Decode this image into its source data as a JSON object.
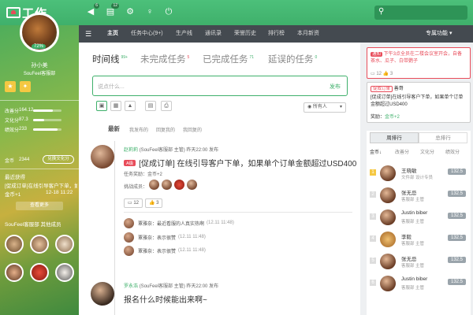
{
  "topbar": {
    "logo_text": "工作",
    "icons": [
      {
        "name": "speaker-icon",
        "badge": "6"
      },
      {
        "name": "notes-icon",
        "badge": "12"
      },
      {
        "name": "settings-icon",
        "badge": ""
      },
      {
        "name": "bulb-icon",
        "badge": ""
      },
      {
        "name": "location-icon",
        "badge": ""
      },
      {
        "name": "power-icon",
        "badge": ""
      }
    ]
  },
  "profile": {
    "name": "孙小美",
    "role": "SouFeel客服部",
    "progress_label": "72%",
    "stats": [
      {
        "label": "改善分",
        "value": "164.12",
        "fill": 0.7
      },
      {
        "label": "文化分",
        "value": "87.3",
        "fill": 0.4
      },
      {
        "label": "绩效分",
        "value": "233",
        "fill": 0.85
      }
    ],
    "gold_label": "金币",
    "gold_value": "2344",
    "convert_label": "兑换文化分",
    "recent_title": "最近获得",
    "recent_text": "[促成订单]在线引导客户下单，如果单个...",
    "recent_reward": "金币+1",
    "recent_time": "12-18 11:22",
    "more_label": "查看更多",
    "members_title": "SouFeel客服部 其他成员"
  },
  "nav": {
    "items": [
      "主页",
      "任务中心(9+)",
      "生产线",
      "通讯录",
      "荣誉历史",
      "排行榜",
      "本月新资"
    ],
    "right": "专属功能"
  },
  "main": {
    "tabs": [
      {
        "label": "时间线",
        "count": "99+"
      },
      {
        "label": "未完成任务",
        "count": "5"
      },
      {
        "label": "已完成任务",
        "count": "71"
      },
      {
        "label": "延误的任务",
        "count": "0"
      }
    ],
    "compose_placeholder": "说点什么...",
    "publish_label": "发布",
    "visibility": "所有人",
    "feed_tabs": [
      "最新",
      "我发布的",
      "回复我的",
      "我回复的"
    ],
    "post1": {
      "author": "赵莉莉",
      "dept": "(SouFeel客服部 主管)",
      "time": "昨天22:00 发布",
      "tag": "A级",
      "title": "[促成订单] 在线引导客户下单，如果单个订单金额超过USD400",
      "reward_label": "任务奖励：",
      "reward_value": "金币+2",
      "members_label": "挑战成员：",
      "comments": "12",
      "likes": "3"
    },
    "replies": [
      {
        "name": "覃雅奈",
        "text": "最近看服的人真实热啊",
        "time": "(12.11 11:48)"
      },
      {
        "name": "覃雅奈",
        "text": "表示很赞",
        "time": "(12.11 11:48)"
      },
      {
        "name": "覃雅奈",
        "text": "表示很赞",
        "time": "(12.11 11:48)"
      }
    ],
    "post2": {
      "author": "罗永浩",
      "dept": "(SouFeel客服部 主管)",
      "time": "昨天22:00 发布",
      "title": "报名什么时候能出来啊~"
    }
  },
  "notices": [
    {
      "tag": "通知",
      "text": "下午3点全员在二楼会议室开会，自备茶水、瓜子、白带鹦子",
      "comments": "12",
      "likes": "3"
    },
    {
      "tag": "促成订单",
      "author": "善哥",
      "text": "[促成订单]在线引导客户下单，如果单个订单金额超过USD400",
      "reward_label": "奖励：",
      "reward_value": "金币+2"
    }
  ],
  "ranking": {
    "tabs": [
      "周排行",
      "总排行"
    ],
    "cols": [
      "金币↓",
      "改善分",
      "文化分",
      "绩效分"
    ],
    "rows": [
      {
        "rank": "1",
        "name": "王晓敏",
        "dept": "文件部 设计专员",
        "score": "132.5"
      },
      {
        "rank": "2",
        "name": "张无忌",
        "dept": "客服部 主管",
        "score": "132.5"
      },
      {
        "rank": "3",
        "name": "Justin biber",
        "dept": "客服部 主管",
        "score": "132.5"
      },
      {
        "rank": "4",
        "name": "李毅",
        "dept": "客服部 主管",
        "score": "132.5"
      },
      {
        "rank": "5",
        "name": "张无忌",
        "dept": "客服部 主管",
        "score": "132.5"
      },
      {
        "rank": "6",
        "name": "Justin biber",
        "dept": "客服部 主管",
        "score": "132.5"
      }
    ]
  },
  "colors": {
    "brand": "#3fb06b",
    "alert": "#e84c5a",
    "nav": "#444a50"
  }
}
